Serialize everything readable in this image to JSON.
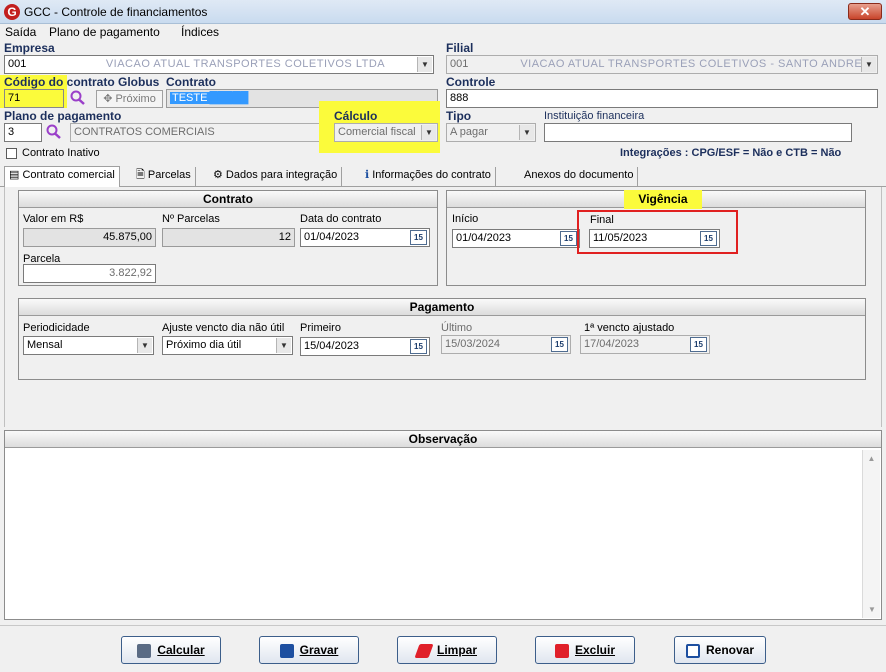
{
  "window": {
    "title": "GCC - Controle de financiamentos",
    "close": "✕"
  },
  "menu": [
    "Saída",
    "Plano de pagamento",
    "Índices"
  ],
  "header": {
    "empresa_label": "Empresa",
    "empresa_code": "001",
    "empresa_name": "VIACAO ATUAL TRANSPORTES COLETIVOS LTDA",
    "filial_label": "Filial",
    "filial_code": "001",
    "filial_name": "VIACAO ATUAL TRANSPORTES COLETIVOS - SANTO ANDRE",
    "codigo_label_hl": "Código do",
    "codigo_label_rest": " contrato Globus",
    "codigo_value": "71",
    "proximo_label": "Próximo",
    "contrato_label": "Contrato",
    "contrato_value": "TESTE",
    "controle_label": "Controle",
    "controle_value": "888",
    "plano_label": "Plano de pagamento",
    "plano_code": "3",
    "plano_name": "CONTRATOS COMERCIAIS",
    "calculo_label": "Cálculo",
    "calculo_value": "Comercial fiscal",
    "tipo_label": "Tipo",
    "tipo_value": "A pagar",
    "instituicao_label": "Instituição financeira",
    "instituicao_value": "",
    "inativo_label": "Contrato Inativo",
    "integracoes": "Integrações : CPG/ESF = Não e CTB = Não"
  },
  "tabs": [
    "Contrato comercial",
    "Parcelas",
    "Dados para integração",
    "Informações do contrato",
    "Anexos do documento"
  ],
  "contrato": {
    "title": "Contrato",
    "valor_label": "Valor em R$",
    "valor": "45.875,00",
    "nparcelas_label": "Nº Parcelas",
    "nparcelas": "12",
    "data_label": "Data do contrato",
    "data": "01/04/2023",
    "parcela_label": "Parcela",
    "parcela": "3.822,92"
  },
  "vigencia": {
    "title": "Vigência",
    "inicio_label": "Início",
    "inicio": "01/04/2023",
    "final_label": "Final",
    "final": "11/05/2023"
  },
  "pagamento": {
    "title": "Pagamento",
    "periodicidade_label": "Periodicidade",
    "periodicidade": "Mensal",
    "ajuste_label": "Ajuste vencto dia não útil",
    "ajuste": "Próximo dia útil",
    "primeiro_label": "Primeiro",
    "primeiro": "15/04/2023",
    "ultimo_label": "Último",
    "ultimo": "15/03/2024",
    "vencto_label": "1ª vencto ajustado",
    "vencto": "17/04/2023"
  },
  "observacao": {
    "title": "Observação",
    "text": ""
  },
  "buttons": {
    "calcular": "Calcular",
    "gravar": "Gravar",
    "limpar": "Limpar",
    "excluir": "Excluir",
    "renovar": "Renovar"
  },
  "calendar_icon_text": "15",
  "colors": {
    "highlight": "#fbfb3b",
    "red_box": "#e02020",
    "accent": "#1c2f5c"
  }
}
